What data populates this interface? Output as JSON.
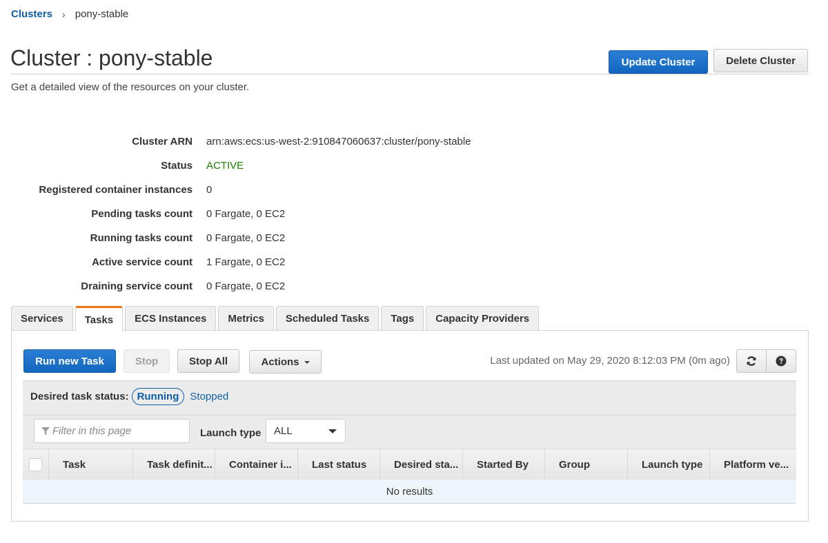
{
  "breadcrumb": {
    "parent": "Clusters",
    "separator": "›",
    "current": "pony-stable"
  },
  "header": {
    "title": "Cluster : pony-stable",
    "subtitle": "Get a detailed view of the resources on your cluster.",
    "update_button": "Update Cluster",
    "delete_button": "Delete Cluster"
  },
  "details": [
    {
      "label": "Cluster ARN",
      "value": "arn:aws:ecs:us-west-2:910847060637:cluster/pony-stable"
    },
    {
      "label": "Status",
      "value": "ACTIVE"
    },
    {
      "label": "Registered container instances",
      "value": "0"
    },
    {
      "label": "Pending tasks count",
      "value": "0 Fargate, 0 EC2"
    },
    {
      "label": "Running tasks count",
      "value": "0 Fargate, 0 EC2"
    },
    {
      "label": "Active service count",
      "value": "1 Fargate, 0 EC2"
    },
    {
      "label": "Draining service count",
      "value": "0 Fargate, 0 EC2"
    }
  ],
  "colors": {
    "primary": "#1366bf",
    "link": "#0f5ea8",
    "status_active": "#1d8102",
    "active_tab_accent": "#ec7211"
  },
  "tabs": [
    {
      "label": "Services",
      "active": false
    },
    {
      "label": "Tasks",
      "active": true
    },
    {
      "label": "ECS Instances",
      "active": false
    },
    {
      "label": "Metrics",
      "active": false
    },
    {
      "label": "Scheduled Tasks",
      "active": false
    },
    {
      "label": "Tags",
      "active": false
    },
    {
      "label": "Capacity Providers",
      "active": false
    }
  ],
  "toolbar": {
    "run_task": "Run new Task",
    "stop": "Stop",
    "stop_all": "Stop All",
    "actions": "Actions",
    "last_updated": "Last updated on May 29, 2020 8:12:03 PM (0m ago)",
    "refresh_icon": "refresh-icon",
    "help_icon": "question-circle-icon"
  },
  "filters": {
    "desired_status_label": "Desired task status:",
    "status_options": [
      "Running",
      "Stopped"
    ],
    "selected_status": "Running",
    "filter_placeholder": "Filter in this page",
    "filter_value": "",
    "launch_type_label": "Launch type",
    "launch_type_value": "ALL"
  },
  "table": {
    "columns": [
      "Task",
      "Task definit...",
      "Container i...",
      "Last status",
      "Desired sta...",
      "Started By",
      "Group",
      "Launch type",
      "Platform ve..."
    ],
    "empty_message": "No results",
    "rows": []
  }
}
